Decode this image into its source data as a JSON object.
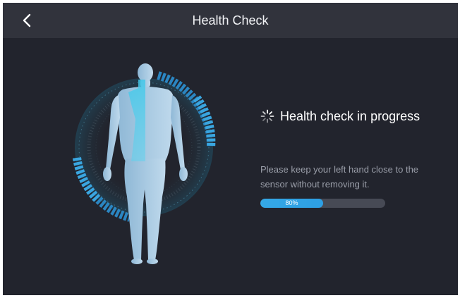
{
  "header": {
    "title": "Health Check",
    "back_icon": "chevron-left-icon"
  },
  "figure": {
    "icon": "human-body-scan-icon"
  },
  "status": {
    "icon": "loading-spinner-icon",
    "text": "Health check in progress"
  },
  "instruction": {
    "text": "Please keep your left hand close to the sensor without removing it."
  },
  "progress": {
    "value": 0.8,
    "label": "80%"
  },
  "colors": {
    "background": "#22242d",
    "topbar": "#31333c",
    "accent": "#35a8e6",
    "track": "#474a55"
  }
}
